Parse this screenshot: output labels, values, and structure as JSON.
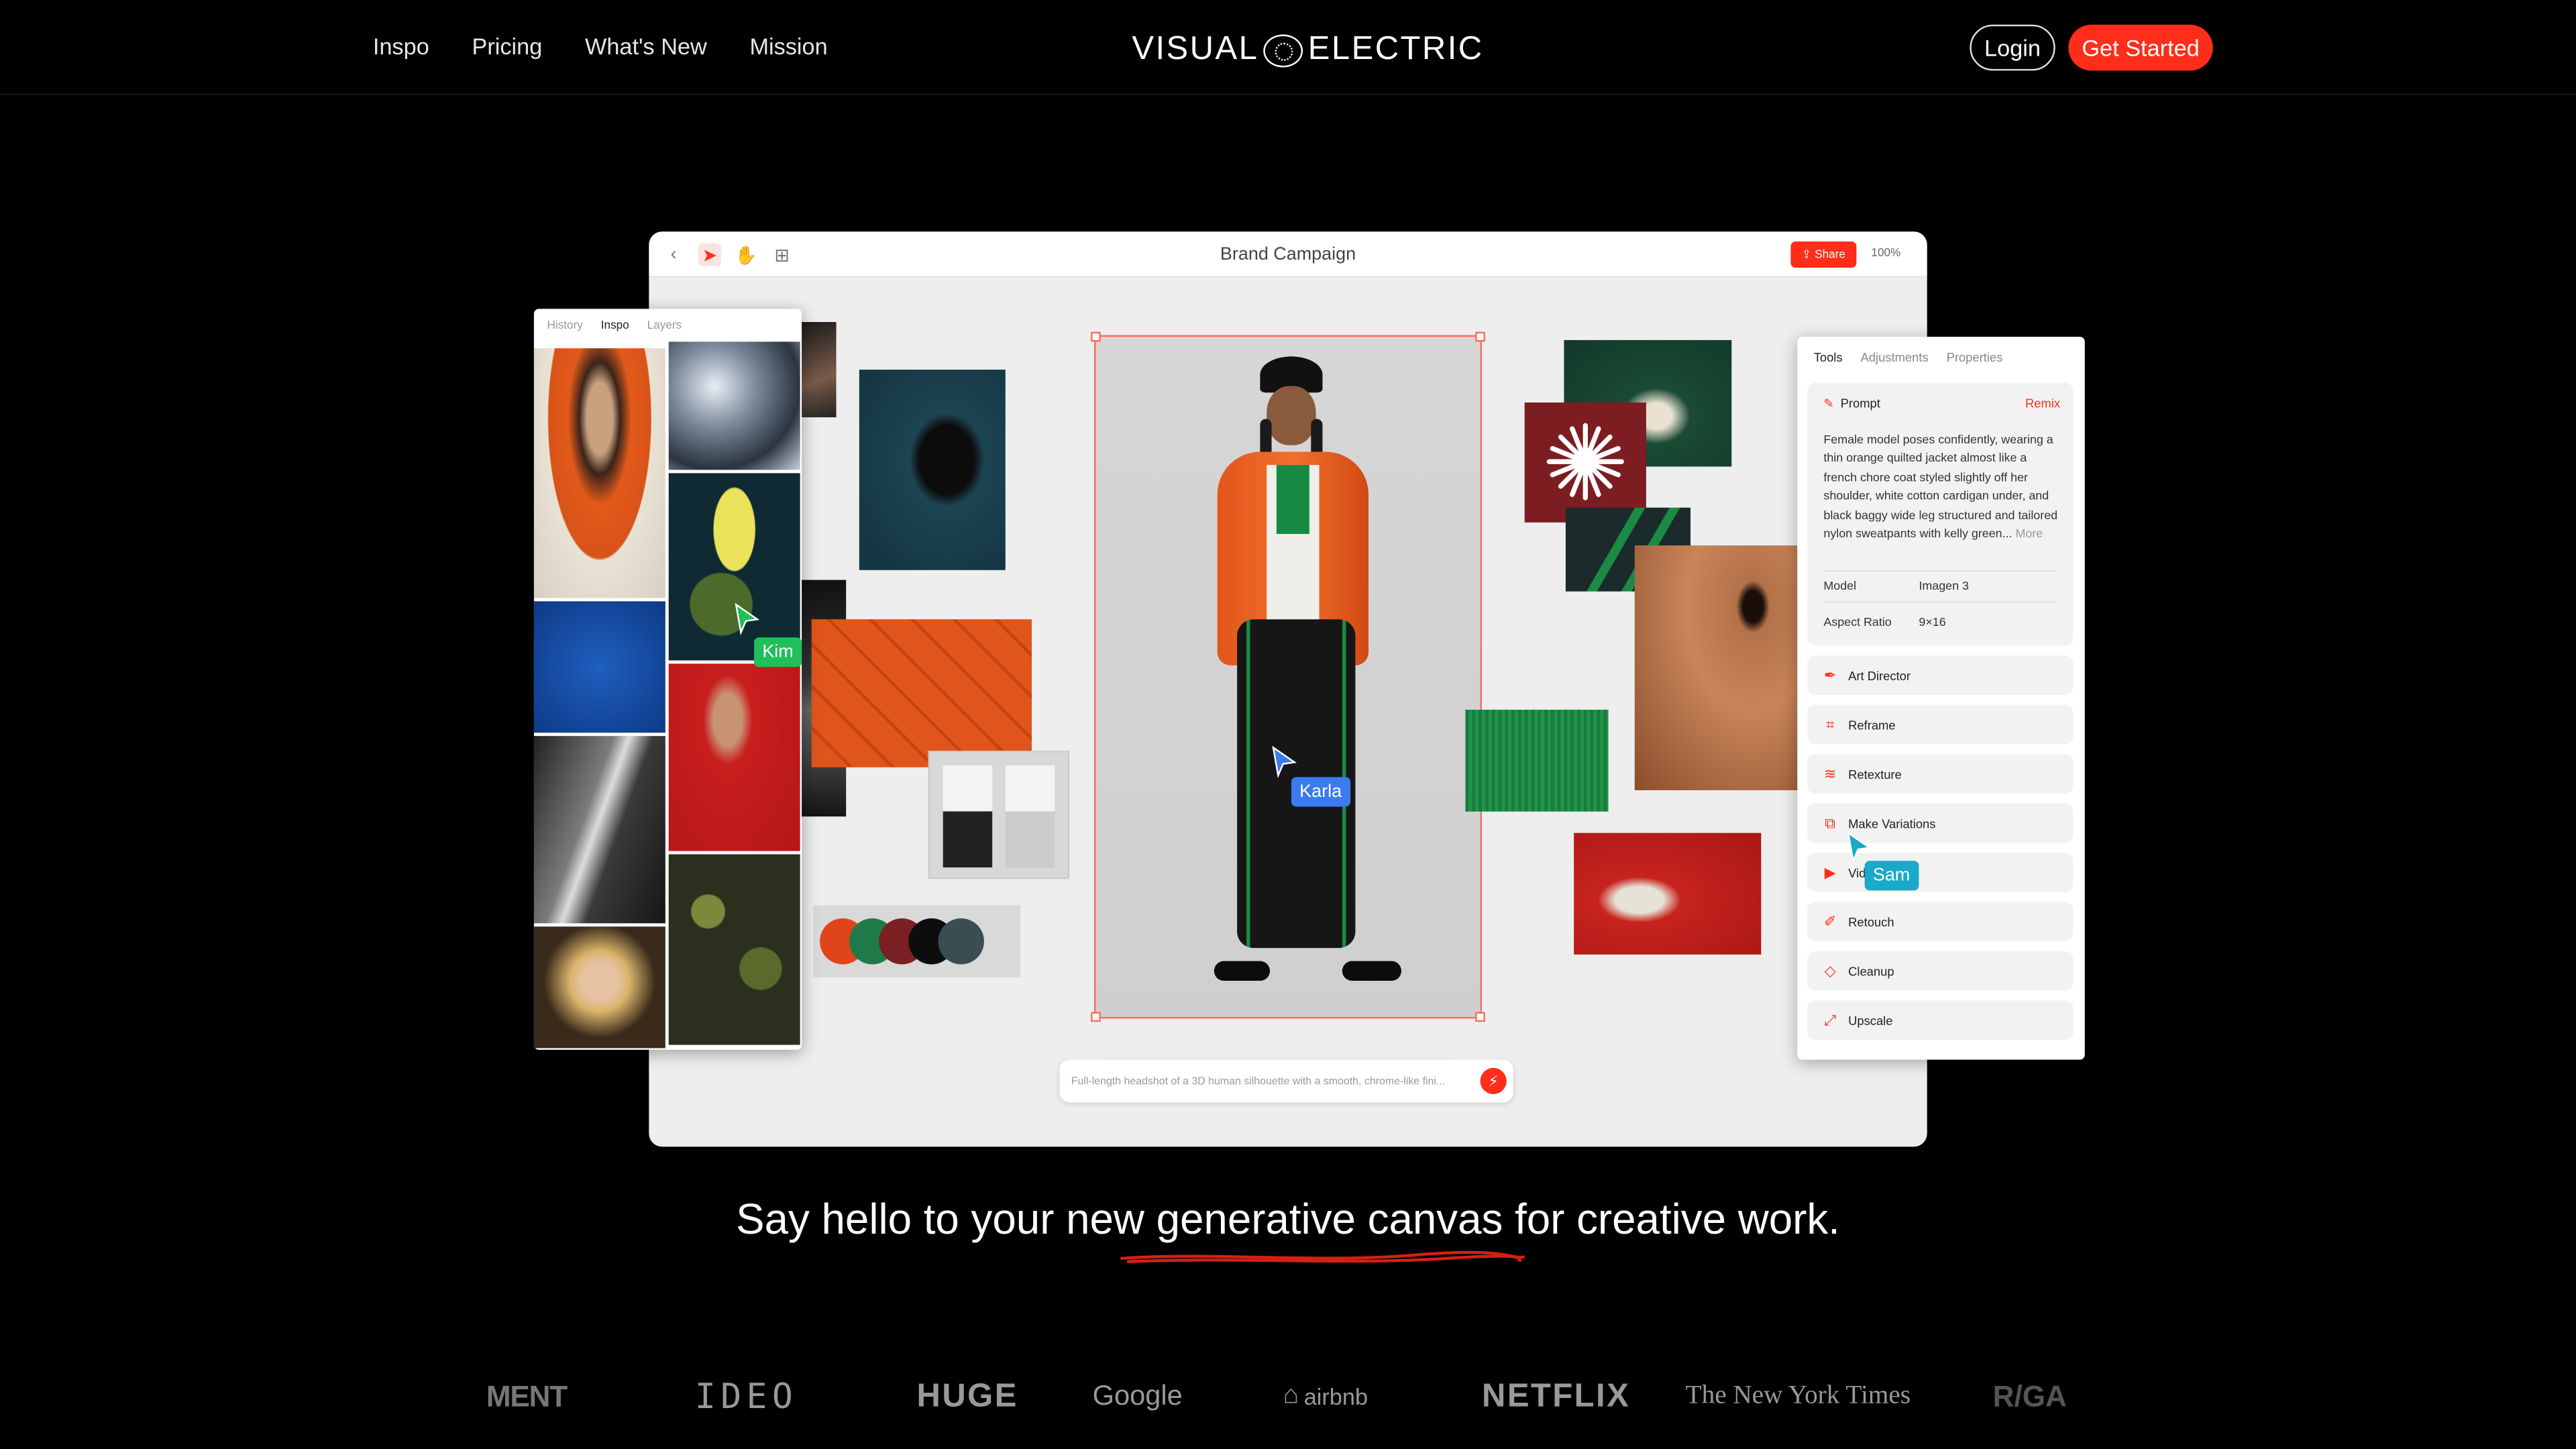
{
  "nav": {
    "links": [
      "Inspo",
      "Pricing",
      "What's New",
      "Mission"
    ],
    "logo_left": "VISUAL",
    "logo_right": "ELECTRIC",
    "login": "Login",
    "get_started": "Get Started"
  },
  "app": {
    "title": "Brand Campaign",
    "share": "Share",
    "zoom": "100%",
    "prompt_placeholder": "Full-length headshot of a 3D human silhouette with a smooth, chrome-like fini...",
    "left_tabs": [
      "History",
      "Inspo",
      "Layers"
    ],
    "palette": [
      "#e0441b",
      "#1f7a4a",
      "#7a1f22",
      "#0d0d0d",
      "#3a4d52"
    ]
  },
  "right_panel": {
    "tabs": [
      "Tools",
      "Adjustments",
      "Properties"
    ],
    "prompt_label": "Prompt",
    "remix": "Remix",
    "prompt_text": "Female model poses confidently, wearing a thin orange quilted jacket almost like a french chore coat styled slightly off her shoulder, white cotton cardigan under, and black baggy wide leg structured and tailored nylon sweatpants with kelly green...",
    "more": "More",
    "model_label": "Model",
    "model_value": "Imagen 3",
    "aspect_label": "Aspect Ratio",
    "aspect_value": "9×16",
    "tools": [
      {
        "label": "Art Director",
        "icon": "pen-icon"
      },
      {
        "label": "Reframe",
        "icon": "crop-icon"
      },
      {
        "label": "Retexture",
        "icon": "texture-icon"
      },
      {
        "label": "Make Variations",
        "icon": "variations-icon"
      },
      {
        "label": "Vid",
        "icon": "video-icon"
      },
      {
        "label": "Retouch",
        "icon": "retouch-icon"
      },
      {
        "label": "Cleanup",
        "icon": "eraser-icon"
      },
      {
        "label": "Upscale",
        "icon": "upscale-icon"
      }
    ]
  },
  "cursors": {
    "kim": "Kim",
    "karla": "Karla",
    "sam": "Sam",
    "kim_color": "#1fbf5a",
    "karla_color": "#3a7bf0",
    "sam_color": "#1aa9c9"
  },
  "hero": {
    "tagline": "Say hello to your new generative canvas for creative work."
  },
  "client_logos": [
    "MENT",
    "IDEO",
    "HUGE",
    "Google",
    "airbnb",
    "NETFLIX",
    "The New York Times",
    "R/GA"
  ]
}
